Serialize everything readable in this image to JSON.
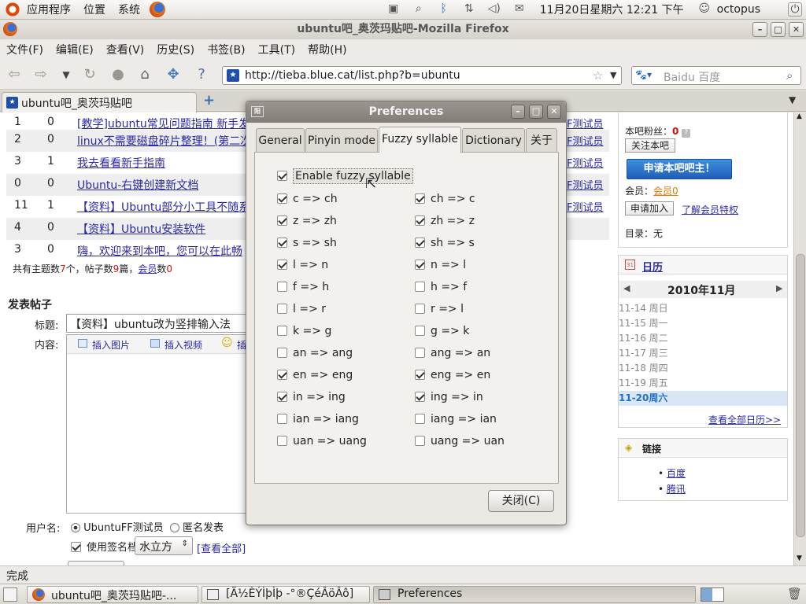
{
  "top_panel": {
    "menus": [
      "应用程序",
      "位置",
      "系统"
    ],
    "datetime": "11月20日星期六 12:21 下午",
    "user": "octopus"
  },
  "browser": {
    "window_title": "ubuntu吧_奥茨玛贴吧-Mozilla Firefox",
    "menus": [
      "文件(F)",
      "编辑(E)",
      "查看(V)",
      "历史(S)",
      "书签(B)",
      "工具(T)",
      "帮助(H)"
    ],
    "url": "http://tieba.blue.cat/list.php?b=ubuntu",
    "search_placeholder": "Baidu 百度",
    "tab_title": "ubuntu吧_奥茨玛贴吧",
    "status": "完成"
  },
  "page": {
    "rows": [
      {
        "c1": "1",
        "c2": "0",
        "title": "[教学]ubuntu常见问题指南 新手发",
        "user": "F测试员"
      },
      {
        "c1": "2",
        "c2": "0",
        "title": "linux不需要磁盘碎片整理！(第二次",
        "user": "F测试员"
      },
      {
        "c1": "3",
        "c2": "1",
        "title": "我去看看新手指南",
        "user": "F测试员"
      },
      {
        "c1": "0",
        "c2": "0",
        "title": "Ubuntu-右键创建新文档",
        "user": "F测试员"
      },
      {
        "c1": "11",
        "c2": "1",
        "title": "【资料】Ubuntu部分小工具不随系",
        "user": "F测试员"
      },
      {
        "c1": "4",
        "c2": "0",
        "title": "【资料】Ubuntu安装软件",
        "user": ""
      },
      {
        "c1": "3",
        "c2": "0",
        "title": "嗨，欢迎来到本吧，您可以在此畅",
        "user": ""
      }
    ],
    "summary": {
      "p1": "共有主题数",
      "topics": "7",
      "p2": "个，帖子数",
      "posts": "9",
      "p3": "篇，",
      "member_link": "会员",
      "p4": "数",
      "members": "0"
    },
    "post_heading": "发表帖子",
    "title_label": "标题:",
    "title_value": "【资料】ubuntu改为竖排输入法",
    "content_label": "内容:",
    "insert_image": "插入图片",
    "insert_video": "插入视频",
    "insert_emoticon": "插",
    "username_label": "用户名:",
    "username_option": "UbuntuFF测试员",
    "anonymous_option": "匿名发表",
    "signature_label": "使用签名档",
    "signature_value": "水立方",
    "view_all": "[查看全部]",
    "sidebar": {
      "fans_label": "本吧粉丝：",
      "fans_count": "0",
      "follow_button": "关注本吧",
      "apply_owner": "申请本吧吧主！",
      "member_label": "会员：",
      "member_link": "会员0",
      "join_button": "申请加入",
      "learn_privileges": "了解会员特权",
      "catalog_label": "目录：",
      "catalog_value": "无",
      "calendar_title": "日历",
      "calendar_month": "2010年11月",
      "calendar_days": [
        "11-14 周日",
        "11-15 周一",
        "11-16 周二",
        "11-17 周三",
        "11-18 周四",
        "11-19 周五",
        "11-20周六"
      ],
      "view_calendar": "查看全部日历>>",
      "links_title": "链接",
      "links": [
        "百度",
        "腾讯"
      ]
    }
  },
  "dialog": {
    "title": "Preferences",
    "tabs": [
      "General",
      "Pinyin mode",
      "Fuzzy syllable",
      "Dictionary",
      "关于"
    ],
    "active_tab": "Fuzzy syllable",
    "enable": {
      "label": "Enable fuzzy syllable",
      "checked": true
    },
    "left_options": [
      {
        "label": "c => ch",
        "checked": true
      },
      {
        "label": "z => zh",
        "checked": true
      },
      {
        "label": "s => sh",
        "checked": true
      },
      {
        "label": "l => n",
        "checked": true
      },
      {
        "label": "f => h",
        "checked": false
      },
      {
        "label": "l => r",
        "checked": false
      },
      {
        "label": "k => g",
        "checked": false
      },
      {
        "label": "an => ang",
        "checked": false
      },
      {
        "label": "en => eng",
        "checked": true
      },
      {
        "label": "in => ing",
        "checked": true
      },
      {
        "label": "ian => iang",
        "checked": false
      },
      {
        "label": "uan => uang",
        "checked": false
      }
    ],
    "right_options": [
      {
        "label": "ch => c",
        "checked": true
      },
      {
        "label": "zh => z",
        "checked": true
      },
      {
        "label": "sh => s",
        "checked": true
      },
      {
        "label": "n => l",
        "checked": true
      },
      {
        "label": "h => f",
        "checked": false
      },
      {
        "label": "r => l",
        "checked": false
      },
      {
        "label": "g => k",
        "checked": false
      },
      {
        "label": "ang => an",
        "checked": false
      },
      {
        "label": "eng => en",
        "checked": true
      },
      {
        "label": "ing => in",
        "checked": true
      },
      {
        "label": "iang => ian",
        "checked": false
      },
      {
        "label": "uang => uan",
        "checked": false
      }
    ],
    "close_button": "关闭(C)"
  },
  "taskbar": {
    "tasks": [
      "ubuntu吧_奥茨玛贴吧-...",
      "[Ä½ÈÝÌþÌþ -°®ÇéÂöÂô]",
      "Preferences"
    ]
  },
  "colors": {
    "link": "#2a2aa8",
    "accent_blue": "#1f6fc8",
    "red": "#d01010"
  }
}
